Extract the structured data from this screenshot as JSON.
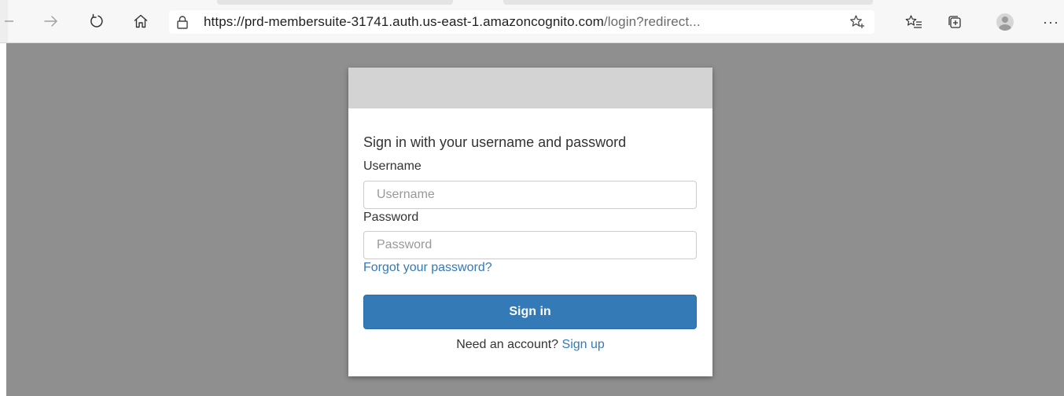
{
  "browser": {
    "url_host": "https://prd-membersuite-31741.auth.us-east-1.amazoncognito.com",
    "url_path": "/login?redirect...",
    "more_label": "···",
    "icons": {
      "back": "back-arrow-icon",
      "forward": "forward-arrow-icon",
      "refresh": "refresh-icon",
      "home": "home-icon",
      "lock": "lock-icon",
      "favorite": "star-plus-icon",
      "favorites": "favorites-icon",
      "collections": "collections-icon",
      "profile": "profile-avatar-icon",
      "more": "more-icon"
    }
  },
  "login": {
    "title": "Sign in with your username and password",
    "username_label": "Username",
    "username_placeholder": "Username",
    "username_value": "",
    "password_label": "Password",
    "password_placeholder": "Password",
    "password_value": "",
    "forgot_link": "Forgot your password?",
    "signin_button": "Sign in",
    "signup_prompt": "Need an account?",
    "signup_link": "Sign up"
  },
  "colors": {
    "backdrop": "#8f8f8f",
    "banner": "#d3d3d3",
    "accent": "#337ab7",
    "text": "#333333"
  }
}
